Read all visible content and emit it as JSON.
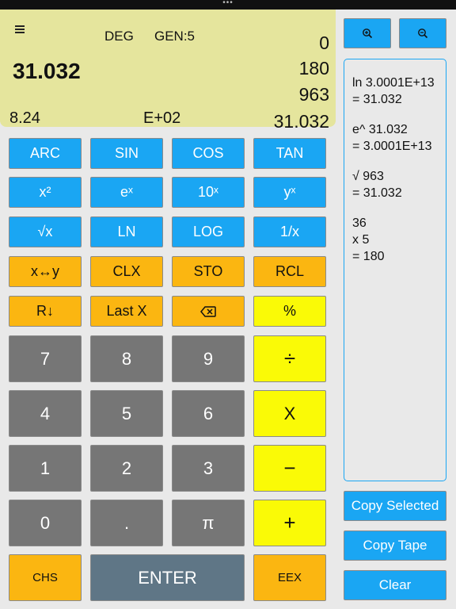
{
  "display": {
    "mode": "DEG",
    "gen": "GEN:5",
    "x": "31.032",
    "stack": [
      "0",
      "180",
      "963",
      "31.032"
    ],
    "mantissa": "8.24",
    "exponent": "E+02"
  },
  "keys": {
    "row1": [
      "ARC",
      "SIN",
      "COS",
      "TAN"
    ],
    "row2": [
      "x²",
      "eˣ",
      "10ˣ",
      "yˣ"
    ],
    "row3": [
      "√x",
      "LN",
      "LOG",
      "1/x"
    ],
    "row4": [
      "x↔y",
      "CLX",
      "STO",
      "RCL"
    ],
    "row5": [
      "R↓",
      "Last X",
      "⌫",
      "%"
    ],
    "row6": [
      "7",
      "8",
      "9",
      "÷"
    ],
    "row7": [
      "4",
      "5",
      "6",
      "X"
    ],
    "row8": [
      "1",
      "2",
      "3",
      "−"
    ],
    "row9": [
      "0",
      ".",
      "π",
      "+"
    ],
    "row10": [
      "CHS",
      "ENTER",
      "EEX"
    ]
  },
  "tape": {
    "entries": [
      [
        "ln 3.0001E+13",
        "=  31.032"
      ],
      [
        "e^ 31.032",
        "=  3.0001E+13"
      ],
      [
        "√  963",
        "=  31.032"
      ],
      [
        "  36",
        "x  5",
        "=  180"
      ]
    ]
  },
  "side": {
    "zoom_in_icon": "zoom-in-icon",
    "zoom_out_icon": "zoom-out-icon",
    "copy_selected": "Copy Selected",
    "copy_tape": "Copy Tape",
    "clear": "Clear"
  },
  "colors": {
    "display_bg": "#e5e59d",
    "function_key": "#1aa6f3",
    "stack_key": "#fbb611",
    "operator_key": "#fafa06",
    "digit_key": "#767676",
    "enter_key": "#5f7686"
  }
}
